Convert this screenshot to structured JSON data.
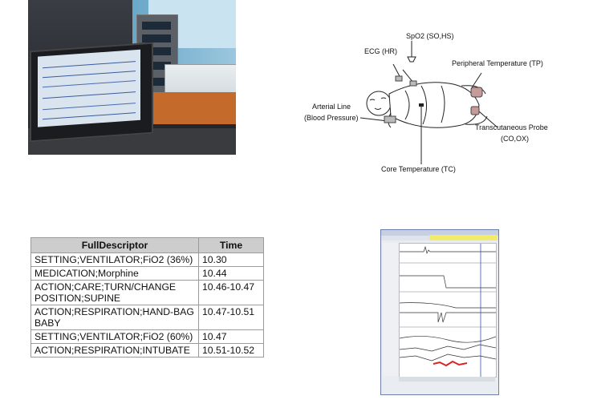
{
  "photo": {
    "alt_name": "nicu-photo"
  },
  "diagram": {
    "labels": {
      "spo2": "SpO2 (SO,HS)",
      "ecg": "ECG (HR)",
      "peripheral_temp": "Peripheral Temperature (TP)",
      "arterial_line_1": "Arterial Line",
      "arterial_line_2": "(Blood Pressure)",
      "transcutaneous_1": "Transcutaneous Probe",
      "transcutaneous_2": "(CO,OX)",
      "core_temp": "Core Temperature (TC)"
    }
  },
  "table": {
    "headers": [
      "FullDescriptor",
      "Time"
    ],
    "rows": [
      [
        "SETTING;VENTILATOR;FiO2 (36%)",
        "10.30"
      ],
      [
        "MEDICATION;Morphine",
        "10.44"
      ],
      [
        "ACTION;CARE;TURN/CHANGE POSITION;SUPINE",
        "10.46-10.47"
      ],
      [
        "ACTION;RESPIRATION;HAND-BAG BABY",
        "10.47-10.51"
      ],
      [
        "SETTING;VENTILATOR;FiO2 (60%)",
        "10.47"
      ],
      [
        "ACTION;RESPIRATION;INTUBATE",
        "10.51-10.52"
      ]
    ]
  },
  "thumbnail": {
    "alt_name": "monitor-software-screenshot"
  }
}
